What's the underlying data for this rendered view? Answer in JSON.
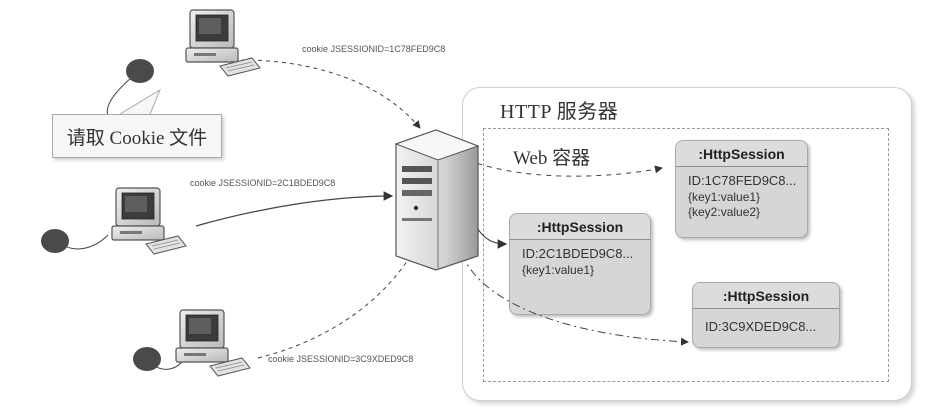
{
  "server_box": {
    "title": "HTTP 服务器"
  },
  "container": {
    "title": "Web 容器"
  },
  "callout": {
    "text": "请取 Cookie 文件"
  },
  "clients": [
    {
      "cookie_label": "cookie JSESSIONID=1C78FED9C8"
    },
    {
      "cookie_label": "cookie JSESSIONID=2C1BDED9C8"
    },
    {
      "cookie_label": "cookie JSESSIONID=3C9XDED9C8"
    }
  ],
  "sessions": [
    {
      "title": ":HttpSession",
      "id": "ID:1C78FED9C8...",
      "entries": [
        "{key1:value1}",
        "{key2:value2}"
      ]
    },
    {
      "title": ":HttpSession",
      "id": "ID:2C1BDED9C8...",
      "entries": [
        "{key1:value1}"
      ]
    },
    {
      "title": ":HttpSession",
      "id": "ID:3C9XDED9C8...",
      "entries": []
    }
  ],
  "colors": {
    "session_fill": "#d6d6d6",
    "outline": "#a9a9a9",
    "user_dot": "#4a4a4a"
  },
  "icons": [
    "computer-icon",
    "server-icon",
    "user-icon"
  ]
}
